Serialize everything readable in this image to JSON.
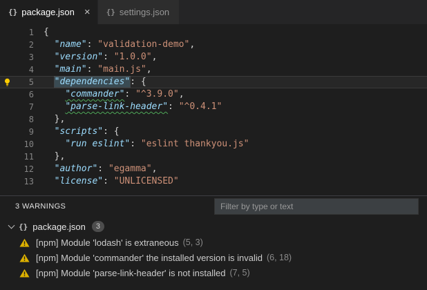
{
  "colors": {
    "key": "#9cdcfe",
    "string": "#ce9178",
    "warning": "#ddb100",
    "squiggle": "#4fa858",
    "editor_bg": "#1e1e1e",
    "tabbar_bg": "#252526"
  },
  "tabs": [
    {
      "id": "package-json",
      "icon": "{}",
      "label": "package.json",
      "close": "×",
      "active": true
    },
    {
      "id": "settings-json",
      "icon": "{}",
      "label": "settings.json",
      "active": false
    }
  ],
  "editor": {
    "lines": [
      {
        "n": "1",
        "t": [
          {
            "c": "p",
            "v": "{"
          }
        ]
      },
      {
        "n": "2",
        "t": [
          {
            "c": "w",
            "v": "  "
          },
          {
            "c": "k",
            "v": "\"name\""
          },
          {
            "c": "p",
            "v": ": "
          },
          {
            "c": "s",
            "v": "\"validation-demo\""
          },
          {
            "c": "p",
            "v": ","
          }
        ]
      },
      {
        "n": "3",
        "t": [
          {
            "c": "w",
            "v": "  "
          },
          {
            "c": "k",
            "v": "\"version\""
          },
          {
            "c": "p",
            "v": ": "
          },
          {
            "c": "s",
            "v": "\"1.0.0\""
          },
          {
            "c": "p",
            "v": ","
          }
        ]
      },
      {
        "n": "4",
        "t": [
          {
            "c": "w",
            "v": "  "
          },
          {
            "c": "k",
            "v": "\"main\""
          },
          {
            "c": "p",
            "v": ": "
          },
          {
            "c": "s",
            "v": "\"main.js\""
          },
          {
            "c": "p",
            "v": ","
          }
        ]
      },
      {
        "n": "5",
        "current": true,
        "lightbulb": true,
        "t": [
          {
            "c": "w",
            "v": "  "
          },
          {
            "c": "k",
            "v": "\"dependencies\"",
            "hl": true
          },
          {
            "c": "p",
            "v": ": {"
          }
        ]
      },
      {
        "n": "6",
        "t": [
          {
            "c": "w",
            "v": "    "
          },
          {
            "c": "k",
            "v": "\"commander\"",
            "sq": true
          },
          {
            "c": "p",
            "v": ": "
          },
          {
            "c": "s",
            "v": "\"^3.9.0\""
          },
          {
            "c": "p",
            "v": ","
          }
        ]
      },
      {
        "n": "7",
        "t": [
          {
            "c": "w",
            "v": "    "
          },
          {
            "c": "k",
            "v": "\"parse-link-header\"",
            "sq": true
          },
          {
            "c": "p",
            "v": ": "
          },
          {
            "c": "s",
            "v": "\"^0.4.1\""
          }
        ]
      },
      {
        "n": "8",
        "t": [
          {
            "c": "w",
            "v": "  "
          },
          {
            "c": "p",
            "v": "},"
          }
        ]
      },
      {
        "n": "9",
        "t": [
          {
            "c": "w",
            "v": "  "
          },
          {
            "c": "k",
            "v": "\"scripts\""
          },
          {
            "c": "p",
            "v": ": {"
          }
        ]
      },
      {
        "n": "10",
        "t": [
          {
            "c": "w",
            "v": "    "
          },
          {
            "c": "k",
            "v": "\"run eslint\""
          },
          {
            "c": "p",
            "v": ": "
          },
          {
            "c": "s",
            "v": "\"eslint thankyou.js\""
          }
        ]
      },
      {
        "n": "11",
        "t": [
          {
            "c": "w",
            "v": "  "
          },
          {
            "c": "p",
            "v": "},"
          }
        ]
      },
      {
        "n": "12",
        "t": [
          {
            "c": "w",
            "v": "  "
          },
          {
            "c": "k",
            "v": "\"author\""
          },
          {
            "c": "p",
            "v": ": "
          },
          {
            "c": "s",
            "v": "\"egamma\""
          },
          {
            "c": "p",
            "v": ","
          }
        ]
      },
      {
        "n": "13",
        "t": [
          {
            "c": "w",
            "v": "  "
          },
          {
            "c": "k",
            "v": "\"license\""
          },
          {
            "c": "p",
            "v": ": "
          },
          {
            "c": "s",
            "v": "\"UNLICENSED\""
          }
        ]
      }
    ]
  },
  "panel": {
    "status": "3 WARNINGS",
    "filter_placeholder": "Filter by type or text",
    "file": {
      "icon": "{}",
      "name": "package.json",
      "badge": "3"
    },
    "items": [
      {
        "icon": "warning-icon",
        "message": "[npm] Module 'lodash' is extraneous",
        "location": "(5, 3)"
      },
      {
        "icon": "warning-icon",
        "message": "[npm] Module 'commander' the installed version is invalid",
        "location": "(6, 18)"
      },
      {
        "icon": "warning-icon",
        "message": "[npm] Module 'parse-link-header' is not installed",
        "location": "(7, 5)"
      }
    ]
  }
}
